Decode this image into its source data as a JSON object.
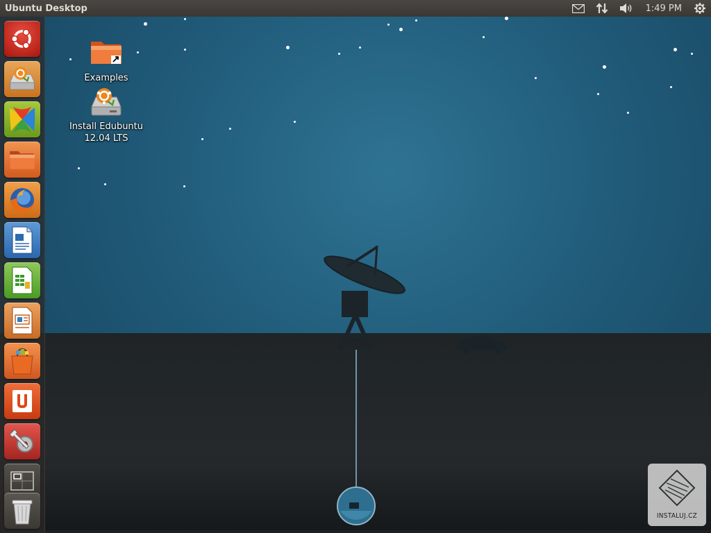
{
  "panel": {
    "title": "Ubuntu Desktop",
    "clock": "1:49 PM",
    "indicators": [
      "mail-icon",
      "network-icon",
      "volume-icon",
      "session-gear-icon"
    ]
  },
  "launcher": {
    "items": [
      {
        "name": "dash-home",
        "icon": "ubuntu-logo-icon"
      },
      {
        "name": "install-edubuntu",
        "icon": "installer-icon"
      },
      {
        "name": "xfce-settings",
        "icon": "xfce-x-icon"
      },
      {
        "name": "home-folder",
        "icon": "folder-icon"
      },
      {
        "name": "firefox",
        "icon": "firefox-icon"
      },
      {
        "name": "libreoffice-writer",
        "icon": "writer-document-icon"
      },
      {
        "name": "libreoffice-calc",
        "icon": "calc-spreadsheet-icon"
      },
      {
        "name": "libreoffice-impress",
        "icon": "impress-presentation-icon"
      },
      {
        "name": "software-center",
        "icon": "shopping-bag-icon"
      },
      {
        "name": "ubuntu-one",
        "icon": "ubuntu-one-icon"
      },
      {
        "name": "system-settings",
        "icon": "wrench-gear-icon"
      },
      {
        "name": "workspace-switcher",
        "icon": "workspaces-icon"
      },
      {
        "name": "trash",
        "icon": "trash-icon"
      }
    ]
  },
  "desktop": {
    "icons": [
      {
        "label": "Examples",
        "icon": "folder-link-icon"
      },
      {
        "label": "Install Edubuntu\n12.04 LTS",
        "line1": "Install Edubuntu",
        "line2": "12.04 LTS",
        "icon": "installer-icon"
      }
    ]
  },
  "watermark": {
    "text": "INSTALUJ.CZ"
  },
  "colors": {
    "panel": "#3c3b37",
    "sky": "#1f5977",
    "ground": "#232729",
    "ubuntu_orange": "#dd4814",
    "ubuntu_red": "#c5281c"
  }
}
